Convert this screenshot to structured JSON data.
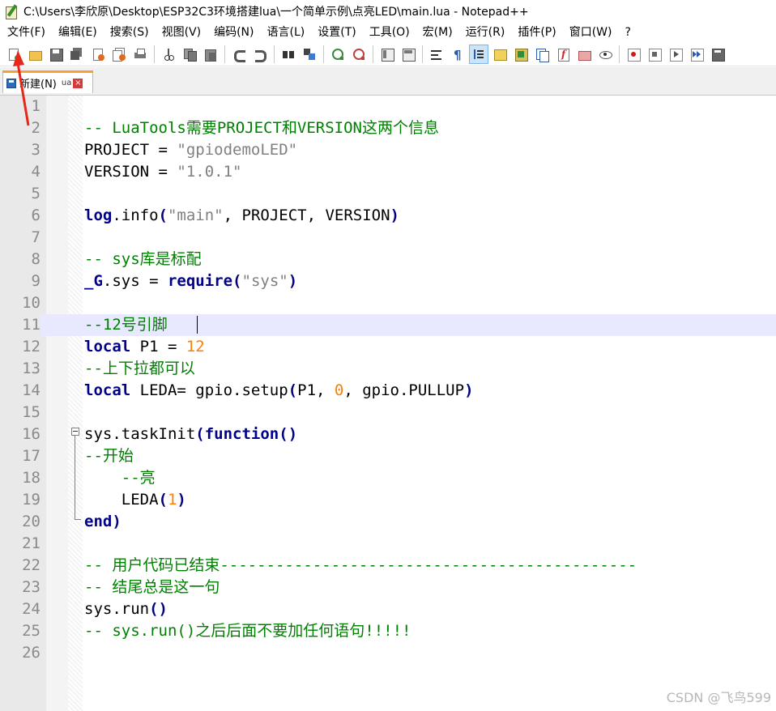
{
  "window": {
    "title": "C:\\Users\\李欣原\\Desktop\\ESP32C3环境搭建lua\\一个简单示例\\点亮LED\\main.lua - Notepad++"
  },
  "menu": [
    "文件(F)",
    "编辑(E)",
    "搜索(S)",
    "视图(V)",
    "编码(N)",
    "语言(L)",
    "设置(T)",
    "工具(O)",
    "宏(M)",
    "运行(R)",
    "插件(P)",
    "窗口(W)",
    "?"
  ],
  "toolbar": {
    "icons": [
      "new-file-icon",
      "open-icon",
      "save-icon",
      "save-all-icon",
      "close-icon",
      "close-all-icon",
      "print-icon",
      "cut-icon",
      "copy-icon",
      "paste-icon",
      "undo-icon",
      "redo-icon",
      "find-icon",
      "replace-icon",
      "zoom-in-icon",
      "zoom-out-icon",
      "sync-vertical-icon",
      "sync-horizontal-icon",
      "word-wrap-icon",
      "show-all-chars-icon",
      "indent-guide-icon",
      "language-icon",
      "doc-map-icon",
      "doc-list-icon",
      "function-list-icon",
      "folder-workspace-icon",
      "monitor-icon",
      "record-macro-icon",
      "stop-macro-icon",
      "play-macro-icon",
      "run-macro-multiple-icon",
      "save-macro-icon"
    ],
    "active_icon": "indent-guide-icon"
  },
  "tab": {
    "label": "新建(N)",
    "ext": "ua",
    "close": "×"
  },
  "editor": {
    "current_line": 11,
    "lines": [
      {
        "n": "1",
        "tokens": []
      },
      {
        "n": "2",
        "tokens": [
          {
            "t": "comment",
            "v": "-- LuaTools需要PROJECT和VERSION这两个信息"
          }
        ]
      },
      {
        "n": "3",
        "tokens": [
          {
            "t": "plain",
            "v": "PROJECT "
          },
          {
            "t": "plain",
            "v": "= "
          },
          {
            "t": "string",
            "v": "\"gpiodemoLED\""
          }
        ]
      },
      {
        "n": "4",
        "tokens": [
          {
            "t": "plain",
            "v": "VERSION "
          },
          {
            "t": "plain",
            "v": "= "
          },
          {
            "t": "string",
            "v": "\"1.0.1\""
          }
        ]
      },
      {
        "n": "5",
        "tokens": []
      },
      {
        "n": "6",
        "tokens": [
          {
            "t": "builtin",
            "v": "log"
          },
          {
            "t": "plain",
            "v": ".info"
          },
          {
            "t": "op",
            "v": "("
          },
          {
            "t": "string",
            "v": "\"main\""
          },
          {
            "t": "plain",
            "v": ", PROJECT, VERSION"
          },
          {
            "t": "op",
            "v": ")"
          }
        ]
      },
      {
        "n": "7",
        "tokens": []
      },
      {
        "n": "8",
        "tokens": [
          {
            "t": "comment",
            "v": "-- sys库是标配"
          }
        ]
      },
      {
        "n": "9",
        "tokens": [
          {
            "t": "builtin",
            "v": "_G"
          },
          {
            "t": "plain",
            "v": ".sys = "
          },
          {
            "t": "keyword",
            "v": "require"
          },
          {
            "t": "op",
            "v": "("
          },
          {
            "t": "string",
            "v": "\"sys\""
          },
          {
            "t": "op",
            "v": ")"
          }
        ]
      },
      {
        "n": "10",
        "tokens": []
      },
      {
        "n": "11",
        "tokens": [
          {
            "t": "comment",
            "v": "--12号引脚"
          }
        ]
      },
      {
        "n": "12",
        "tokens": [
          {
            "t": "keyword",
            "v": "local"
          },
          {
            "t": "plain",
            "v": " P1 = "
          },
          {
            "t": "number",
            "v": "12"
          }
        ]
      },
      {
        "n": "13",
        "tokens": [
          {
            "t": "comment",
            "v": "--上下拉都可以"
          }
        ]
      },
      {
        "n": "14",
        "tokens": [
          {
            "t": "keyword",
            "v": "local"
          },
          {
            "t": "plain",
            "v": " LEDA= gpio.setup"
          },
          {
            "t": "op",
            "v": "("
          },
          {
            "t": "plain",
            "v": "P1, "
          },
          {
            "t": "number",
            "v": "0"
          },
          {
            "t": "plain",
            "v": ", gpio.PULLUP"
          },
          {
            "t": "op",
            "v": ")"
          }
        ]
      },
      {
        "n": "15",
        "tokens": []
      },
      {
        "n": "16",
        "tokens": [
          {
            "t": "plain",
            "v": "sys.taskInit"
          },
          {
            "t": "op",
            "v": "("
          },
          {
            "t": "keyword",
            "v": "function"
          },
          {
            "t": "op",
            "v": "()"
          }
        ]
      },
      {
        "n": "17",
        "tokens": [
          {
            "t": "comment",
            "v": "--开始"
          }
        ]
      },
      {
        "n": "18",
        "tokens": [
          {
            "t": "plain",
            "v": "    "
          },
          {
            "t": "comment",
            "v": "--亮"
          }
        ]
      },
      {
        "n": "19",
        "tokens": [
          {
            "t": "plain",
            "v": "    LEDA"
          },
          {
            "t": "op",
            "v": "("
          },
          {
            "t": "number",
            "v": "1"
          },
          {
            "t": "op",
            "v": ")"
          }
        ]
      },
      {
        "n": "20",
        "tokens": [
          {
            "t": "keyword",
            "v": "end"
          },
          {
            "t": "op",
            "v": ")"
          }
        ]
      },
      {
        "n": "21",
        "tokens": []
      },
      {
        "n": "22",
        "tokens": [
          {
            "t": "comment",
            "v": "-- 用户代码已结束---------------------------------------------"
          }
        ]
      },
      {
        "n": "23",
        "tokens": [
          {
            "t": "comment",
            "v": "-- 结尾总是这一句"
          }
        ]
      },
      {
        "n": "24",
        "tokens": [
          {
            "t": "plain",
            "v": "sys.run"
          },
          {
            "t": "op",
            "v": "()"
          }
        ]
      },
      {
        "n": "25",
        "tokens": [
          {
            "t": "comment",
            "v": "-- sys.run()之后后面不要加任何语句!!!!!"
          }
        ]
      },
      {
        "n": "26",
        "tokens": []
      }
    ]
  },
  "watermark": "CSDN @飞鸟599",
  "colors": {
    "comment": "#008000",
    "string": "#808080",
    "keyword": "#00008b",
    "number": "#ff8000",
    "current_line_bg": "#e8e8ff",
    "tab_accent": "#f7a033",
    "arrow": "#e8261c"
  }
}
